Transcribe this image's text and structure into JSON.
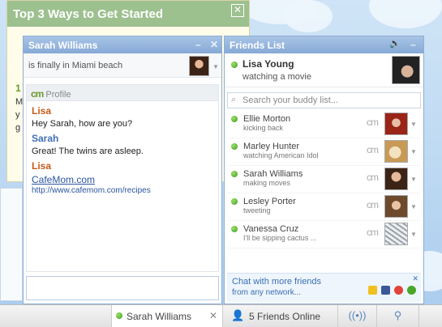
{
  "promo": {
    "title": "Top 3 Ways to Get Started",
    "close_glyph": "✕",
    "peek_number": "1",
    "peek_lines": [
      "M",
      "y",
      "g"
    ]
  },
  "chat": {
    "title": "Sarah Williams",
    "minimize_glyph": "–",
    "close_glyph": "✕",
    "status_text": "is finally in Miami beach",
    "profile_brand": "cm",
    "profile_label": "Profile",
    "messages": [
      {
        "sender": "Lisa",
        "text": "Hey Sarah, how are you?"
      },
      {
        "sender": "Sarah",
        "text": "Great! The twins are asleep."
      },
      {
        "sender": "Lisa",
        "link_text": "CafeMom.com",
        "link_url": "http://www.cafemom.com/recipes"
      }
    ]
  },
  "friends": {
    "title": "Friends List",
    "sound_glyph": "🔈",
    "minimize_glyph": "–",
    "me": {
      "name": "Lisa Young",
      "status": "watching a movie"
    },
    "search_placeholder": "Search your buddy list...",
    "brand": "cm",
    "buddies": [
      {
        "name": "Ellie Morton",
        "status": "kicking back"
      },
      {
        "name": "Marley Hunter",
        "status": "watching American Idol"
      },
      {
        "name": "Sarah Williams",
        "status": "making moves"
      },
      {
        "name": "Lesley Porter",
        "status": "tweeting"
      },
      {
        "name": "Vanessa Cruz",
        "status": "I'll be sipping cactus ..."
      }
    ],
    "more_title": "Chat with more friends",
    "more_sub": "from any network...",
    "more_close": "✕"
  },
  "taskbar": {
    "chat_tab": "Sarah Williams",
    "chat_tab_close": "✕",
    "friends_online": "5 Friends Online"
  },
  "colors": {
    "accent": "#86a9d6",
    "online": "#3e9b1c",
    "lisa": "#c85a1a",
    "sarah": "#3f6fb5"
  }
}
